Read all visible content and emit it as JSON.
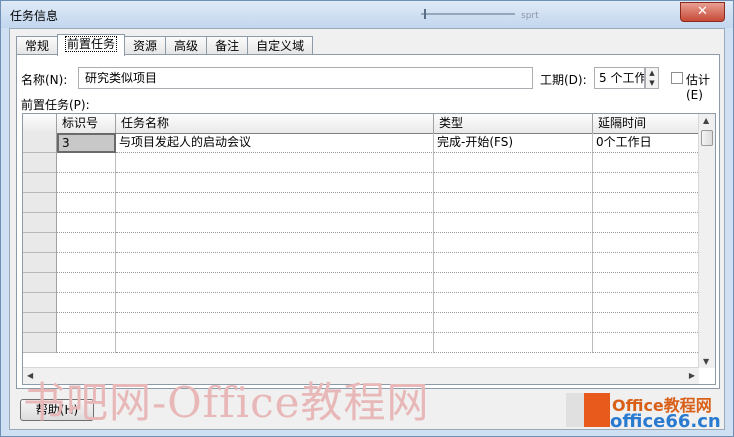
{
  "window": {
    "title": "任务信息",
    "close_glyph": "✕",
    "title_fragment": "sprt"
  },
  "tabs": [
    {
      "label": "常规"
    },
    {
      "label": "前置任务",
      "active": true
    },
    {
      "label": "资源"
    },
    {
      "label": "高级"
    },
    {
      "label": "备注"
    },
    {
      "label": "自定义域"
    }
  ],
  "form": {
    "name_label": "名称(N):",
    "name_value": "研究类似项目",
    "duration_label": "工期(D):",
    "duration_value": "5 个工作",
    "estimate_label": "估计(E)",
    "estimate_checked": false,
    "predecessors_label": "前置任务(P):"
  },
  "grid": {
    "columns": [
      "",
      "标识号",
      "任务名称",
      "类型",
      "延隔时间"
    ],
    "rows": [
      [
        "3",
        "与项目发起人的启动会议",
        "完成-开始(FS)",
        "0个工作日"
      ],
      [
        "",
        "",
        "",
        ""
      ],
      [
        "",
        "",
        "",
        ""
      ],
      [
        "",
        "",
        "",
        ""
      ],
      [
        "",
        "",
        "",
        ""
      ],
      [
        "",
        "",
        "",
        ""
      ],
      [
        "",
        "",
        "",
        ""
      ],
      [
        "",
        "",
        "",
        ""
      ],
      [
        "",
        "",
        "",
        ""
      ],
      [
        "",
        "",
        "",
        ""
      ],
      [
        "",
        "",
        "",
        ""
      ]
    ]
  },
  "buttons": {
    "help": "帮助(H)"
  },
  "watermark": {
    "text": "书吧网-Office教程网",
    "logo_line1": "Office教程网",
    "logo_line2": "office66.cn"
  },
  "icons": {
    "close": "close-icon",
    "spin_up": "spin-up-icon",
    "spin_down": "spin-down-icon",
    "scroll_up": "scroll-up-icon",
    "scroll_down": "scroll-down-icon",
    "scroll_left": "scroll-left-icon",
    "scroll_right": "scroll-right-icon"
  },
  "colors": {
    "close_button": "#c74a36",
    "title_bar": "#cfe0f3",
    "selected_cell": "#c8c8c8"
  }
}
